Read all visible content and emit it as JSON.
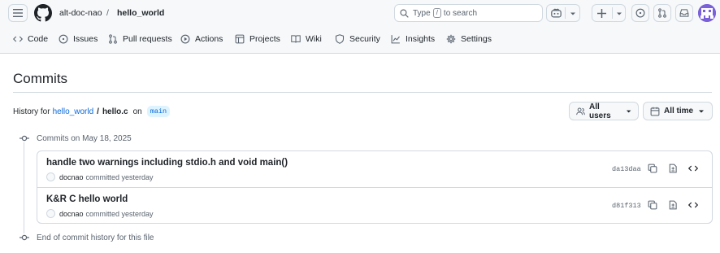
{
  "header": {
    "owner": "alt-doc-nao",
    "separator": "/",
    "repo": "hello_world",
    "search": {
      "prefix": "Type",
      "key": "/",
      "suffix": "to search"
    },
    "icons": [
      "hamburger-icon",
      "github-logo",
      "search-icon",
      "copilot-icon",
      "chevron-down-icon",
      "plus-icon",
      "issue-opened-icon",
      "git-pull-request-icon",
      "inbox-icon",
      "avatar"
    ]
  },
  "tabs": [
    {
      "label": "Code",
      "icon": "code-icon"
    },
    {
      "label": "Issues",
      "icon": "issue-opened-icon"
    },
    {
      "label": "Pull requests",
      "icon": "git-pull-request-icon"
    },
    {
      "label": "Actions",
      "icon": "play-icon"
    },
    {
      "label": "Projects",
      "icon": "table-icon"
    },
    {
      "label": "Wiki",
      "icon": "book-icon"
    },
    {
      "label": "Security",
      "icon": "shield-icon"
    },
    {
      "label": "Insights",
      "icon": "graph-icon"
    },
    {
      "label": "Settings",
      "icon": "gear-icon"
    }
  ],
  "page": {
    "title": "Commits",
    "history_prefix": "History for",
    "history_repo": "hello_world",
    "history_sep": "/",
    "history_file": "hello.c",
    "history_on": "on",
    "branch": "main"
  },
  "filters": {
    "users_label": "All users",
    "time_label": "All time"
  },
  "timeline": {
    "group_label": "Commits on May 18, 2025",
    "end_label": "End of commit history for this file"
  },
  "commits": [
    {
      "message": "handle two warnings including stdio.h and void main()",
      "author": "docnao",
      "meta": "committed yesterday",
      "sha": "da13daa"
    },
    {
      "message": "K&R C hello world",
      "author": "docnao",
      "meta": "committed yesterday",
      "sha": "d81f313"
    }
  ],
  "colors": {
    "header_bg": "#f6f8fa",
    "border": "#d1d9e0",
    "link": "#0969da",
    "branch_bg": "#ddf4ff",
    "muted": "#59636e",
    "avatar": "#7b61d9"
  }
}
